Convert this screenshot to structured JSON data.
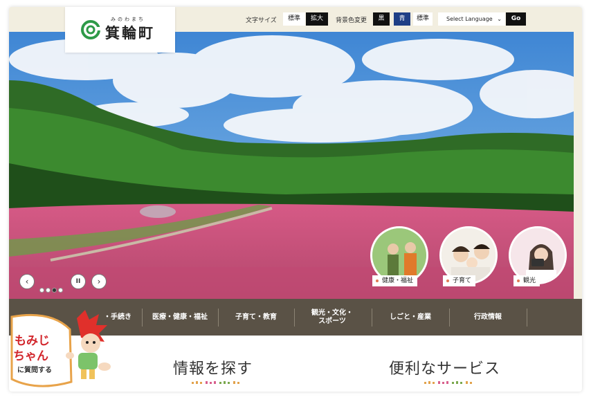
{
  "header": {
    "logo_ruby": "みのわまち",
    "logo_text": "箕輪町",
    "font_size_label": "文字サイズ",
    "font_standard": "標準",
    "font_large": "拡大",
    "bgcolor_label": "背景色変更",
    "bg_black": "黒",
    "bg_blue": "青",
    "bg_standard": "標準",
    "language_select": "Select Language",
    "go_label": "Go"
  },
  "hero": {
    "circles": [
      {
        "label": "健康・福祉"
      },
      {
        "label": "子育て"
      },
      {
        "label": "観光"
      }
    ],
    "prev_icon": "‹",
    "pause_icon": "II",
    "next_icon": "›"
  },
  "nav": {
    "items": [
      {
        "label": "・手続き"
      },
      {
        "label": "医療・健康・福祉"
      },
      {
        "label": "子育て・教育"
      },
      {
        "label": "観光・文化・\nスポーツ"
      },
      {
        "label": "しごと・産業"
      },
      {
        "label": "行政情報"
      }
    ]
  },
  "mascot": {
    "line1": "もみじ",
    "line2": "ちゃん",
    "line3": "に質問する"
  },
  "sections": {
    "search_title": "情報を探す",
    "services_title": "便利なサービス"
  },
  "colors": {
    "nav_bg": "#5a5246",
    "header_bg": "#f2eee0",
    "accent_blue": "#1f3f86",
    "logo_green": "#2e9a48"
  }
}
